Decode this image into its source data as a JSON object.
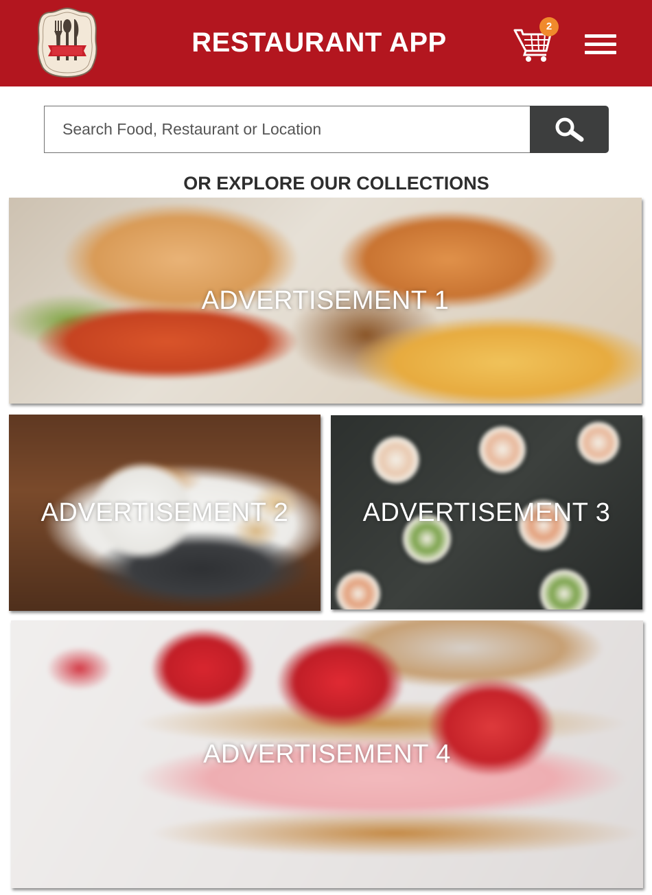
{
  "header": {
    "title": "RESTAURANT APP",
    "logo_icon": "restaurant-logo-icon",
    "cart_icon": "shopping-cart-icon",
    "cart_count": "2",
    "menu_icon": "hamburger-menu-icon",
    "colors": {
      "bar": "#b3161f",
      "badge": "#f08a2c"
    }
  },
  "search": {
    "placeholder": "Search Food, Restaurant or Location",
    "value": "",
    "button_icon": "search-icon",
    "button_color": "#3d3e3e"
  },
  "collections": {
    "title": "OR EXPLORE OUR COLLECTIONS",
    "ads": [
      {
        "label": "ADVERTISEMENT 1"
      },
      {
        "label": "ADVERTISEMENT 2"
      },
      {
        "label": "ADVERTISEMENT 3"
      },
      {
        "label": "ADVERTISEMENT 4"
      }
    ]
  }
}
